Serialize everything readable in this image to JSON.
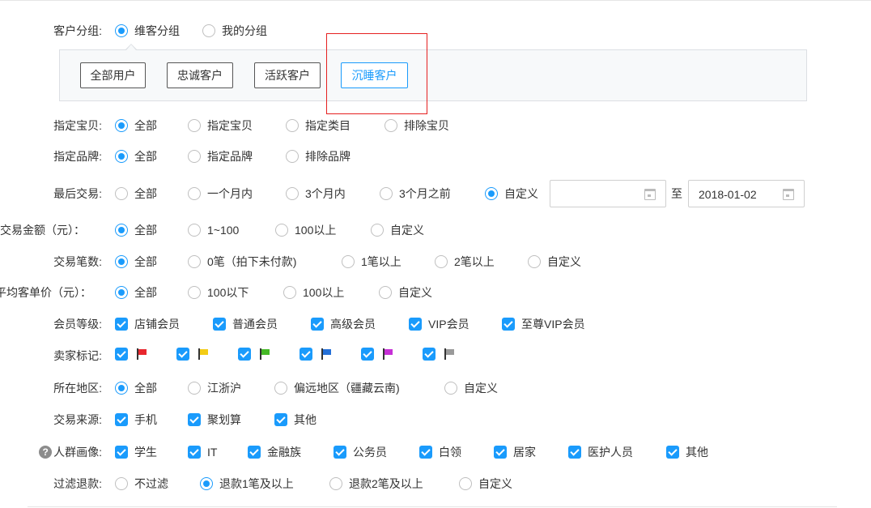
{
  "customer_group": {
    "label": "客户分组:",
    "options": [
      "维客分组",
      "我的分组"
    ],
    "segments": [
      "全部用户",
      "忠诚客户",
      "活跃客户",
      "沉睡客户"
    ]
  },
  "specified_item": {
    "label": "指定宝贝:",
    "options": [
      "全部",
      "指定宝贝",
      "指定类目",
      "排除宝贝"
    ]
  },
  "specified_brand": {
    "label": "指定品牌:",
    "options": [
      "全部",
      "指定品牌",
      "排除品牌"
    ]
  },
  "last_trade": {
    "label": "最后交易:",
    "options": [
      "全部",
      "一个月内",
      "3个月内",
      "3个月之前",
      "自定义"
    ],
    "date_start": "",
    "date_sep": "至",
    "date_end": "2018-01-02"
  },
  "trade_amount": {
    "label": "交易金额（元）：",
    "options": [
      "全部",
      "1~100",
      "100以上",
      "自定义"
    ]
  },
  "trade_count": {
    "label": "交易笔数:",
    "options": [
      "全部",
      "0笔（拍下未付款)",
      "1笔以上",
      "2笔以上",
      "自定义"
    ]
  },
  "avg_price": {
    "label": "平均客单价（元）：",
    "options": [
      "全部",
      "100以下",
      "100以上",
      "自定义"
    ]
  },
  "member_level": {
    "label": "会员等级:",
    "options": [
      "店铺会员",
      "普通会员",
      "高级会员",
      "VIP会员",
      "至尊VIP会员"
    ]
  },
  "seller_flag": {
    "label": "卖家标记:",
    "flags": [
      {
        "icon": "red-flag-icon",
        "color": "#e8262d"
      },
      {
        "icon": "yellow-flag-icon",
        "color": "#f3cc15"
      },
      {
        "icon": "green-flag-icon",
        "color": "#45b926"
      },
      {
        "icon": "blue-flag-icon",
        "color": "#2470d8"
      },
      {
        "icon": "purple-flag-icon",
        "color": "#c62fd6"
      },
      {
        "icon": "gray-flag-icon",
        "color": "#9a9a9a"
      }
    ]
  },
  "region": {
    "label": "所在地区:",
    "options": [
      "全部",
      "江浙沪",
      "偏远地区（疆藏云南)",
      "自定义"
    ]
  },
  "trade_source": {
    "label": "交易来源:",
    "options": [
      "手机",
      "聚划算",
      "其他"
    ]
  },
  "crowd_profile": {
    "label": "人群画像:",
    "help_icon": "?",
    "options": [
      "学生",
      "IT",
      "金融族",
      "公务员",
      "白领",
      "居家",
      "医护人员",
      "其他"
    ]
  },
  "refund_filter": {
    "label": "过滤退款:",
    "options": [
      "不过滤",
      "退款1笔及以上",
      "退款2笔及以上",
      "自定义"
    ]
  },
  "colors": {
    "accent": "#1a9bfc",
    "highlight_box": "#e52020",
    "panel_bg": "#f7f9fa"
  }
}
